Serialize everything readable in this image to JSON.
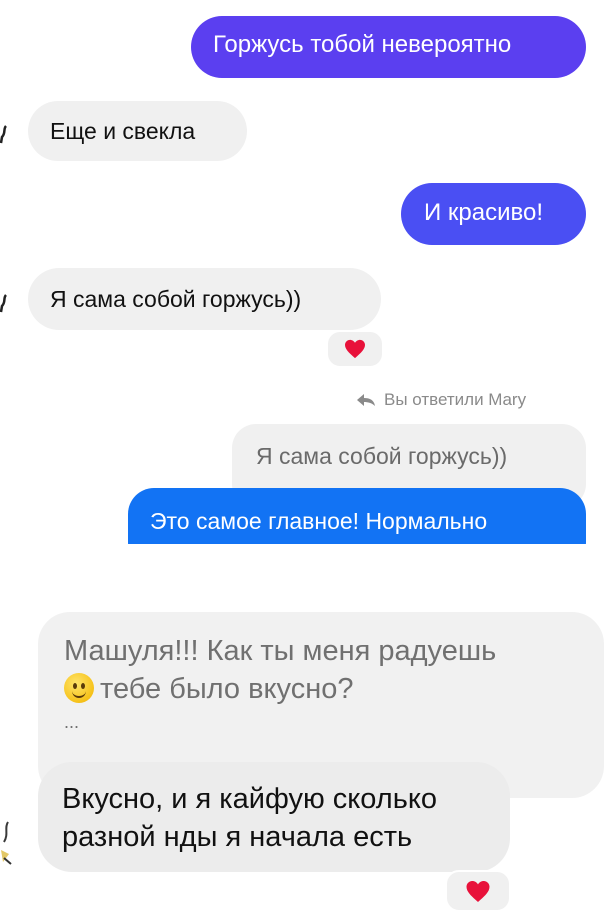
{
  "colors": {
    "outgoing_primary": "#5b3ff0",
    "outgoing_blue": "#1273f4",
    "incoming_bg": "#f0f0f0",
    "reaction_heart": "#e8113a",
    "meta_text": "#8a8a8a"
  },
  "messages": [
    {
      "direction": "out",
      "text": "Горжусь тобой невероятно"
    },
    {
      "direction": "in",
      "text": "Еще и свекла"
    },
    {
      "direction": "out",
      "text": "И красиво!"
    },
    {
      "direction": "in",
      "text": "Я сама собой горжусь))",
      "reaction": "heart"
    }
  ],
  "reply": {
    "label": "Вы ответили Mary",
    "quoted": "Я сама собой горжусь))",
    "text": "Это самое главное! Нормально"
  },
  "second_screen": {
    "quoted_line1": "Машуля!!! Как ты меня радуешь",
    "quoted_line2": "тебе было вкусно?",
    "quoted_more": "...",
    "quoted_emoji": "slightly-smiling-face",
    "reply_line1": "Вкусно, и я кайфую сколько",
    "reply_line2": "разной нды я начала есть",
    "reaction": "heart"
  }
}
